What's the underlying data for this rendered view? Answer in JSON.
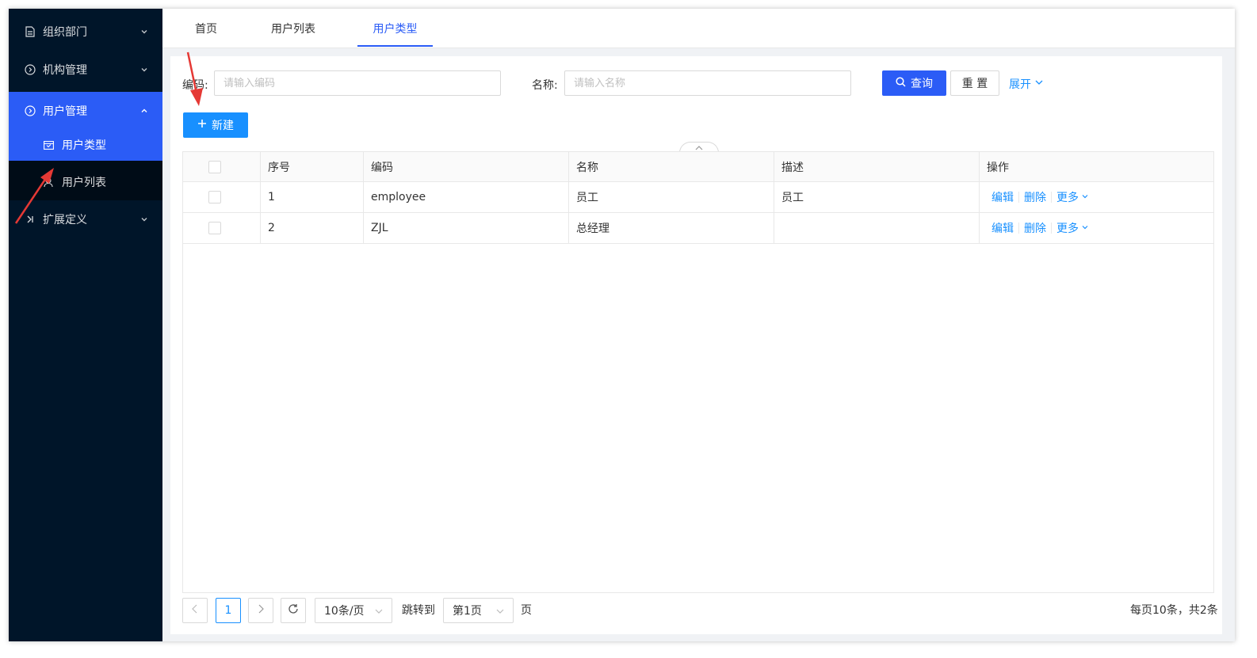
{
  "colors": {
    "sidebar_bg": "#001529",
    "accent": "#2b5cf6",
    "link": "#1890ff",
    "arrow": "#e53935"
  },
  "sidebar": {
    "items": [
      {
        "label": "组织部门",
        "icon": "file-icon"
      },
      {
        "label": "机构管理",
        "icon": "circle-chevron-icon"
      },
      {
        "label": "用户管理",
        "icon": "circle-chevron-icon"
      },
      {
        "label": "扩展定义",
        "icon": "step-forward-icon"
      }
    ],
    "sub_items": [
      {
        "label": "用户类型",
        "icon": "calendar-icon"
      },
      {
        "label": "用户列表",
        "icon": "user-icon"
      }
    ]
  },
  "tabs": [
    {
      "label": "首页"
    },
    {
      "label": "用户列表"
    },
    {
      "label": "用户类型"
    }
  ],
  "search": {
    "code_label": "编码:",
    "code_placeholder": "请输入编码",
    "name_label": "名称:",
    "name_placeholder": "请输入名称",
    "query_label": "查询",
    "reset_label": "重 置",
    "expand_label": "展开"
  },
  "toolbar": {
    "new_label": "新建"
  },
  "table": {
    "columns": [
      "序号",
      "编码",
      "名称",
      "描述",
      "操作"
    ],
    "rows": [
      {
        "index": "1",
        "code": "employee",
        "name": "员工",
        "desc": "员工"
      },
      {
        "index": "2",
        "code": "ZJL",
        "name": "总经理",
        "desc": ""
      }
    ],
    "actions": {
      "edit": "编辑",
      "delete": "删除",
      "more": "更多"
    }
  },
  "pagination": {
    "current_page": "1",
    "page_size": "10条/页",
    "jump_label": "跳转到",
    "jump_value": "第1页",
    "page_suffix": "页",
    "summary": "每页10条，共2条"
  }
}
